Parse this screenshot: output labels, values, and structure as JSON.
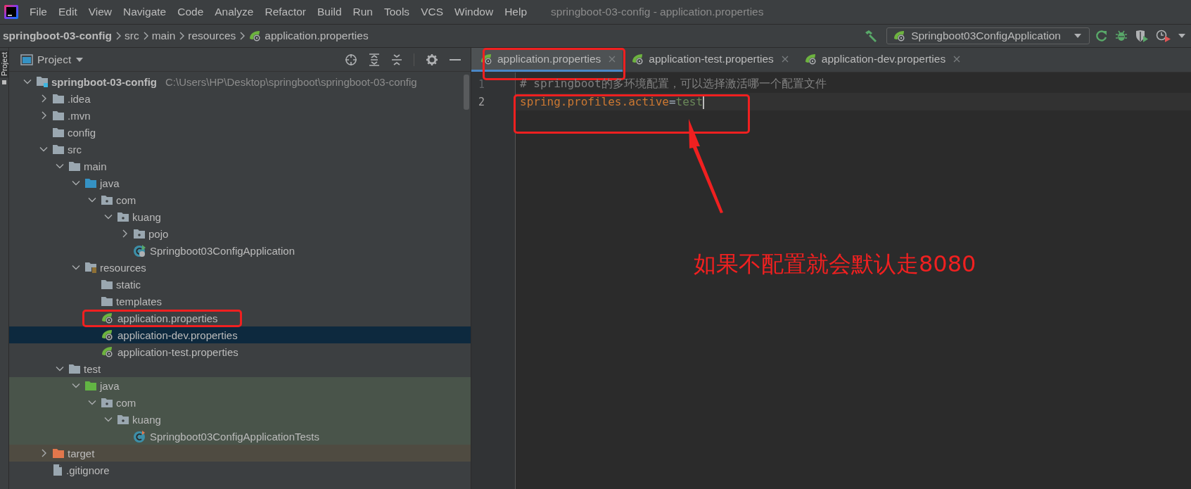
{
  "menu_bar": {
    "items": [
      "File",
      "Edit",
      "View",
      "Navigate",
      "Code",
      "Analyze",
      "Refactor",
      "Build",
      "Run",
      "Tools",
      "VCS",
      "Window",
      "Help"
    ],
    "title": "springboot-03-config - application.properties"
  },
  "navigation_bar": {
    "breadcrumbs": [
      {
        "label": "springboot-03-config",
        "kind": "project"
      },
      {
        "label": "src",
        "kind": "folder"
      },
      {
        "label": "main",
        "kind": "folder"
      },
      {
        "label": "resources",
        "kind": "folder"
      },
      {
        "label": "application.properties",
        "kind": "spring-file"
      }
    ],
    "run_configuration": "Springboot03ConfigApplication"
  },
  "tool_stripe": {
    "label": "Project"
  },
  "project_panel": {
    "title": "Project",
    "tree": [
      {
        "label": "springboot-03-config",
        "path": "C:\\Users\\HP\\Desktop\\springboot\\springboot-03-config",
        "kind": "module",
        "expanded": true,
        "selected": false,
        "children": [
          {
            "label": ".idea",
            "kind": "folder",
            "expanded": false,
            "selected": false
          },
          {
            "label": ".mvn",
            "kind": "folder",
            "expanded": false,
            "selected": false
          },
          {
            "label": "config",
            "kind": "folder",
            "selected": false
          },
          {
            "label": "src",
            "kind": "folder",
            "expanded": true,
            "selected": false,
            "children": [
              {
                "label": "main",
                "kind": "folder",
                "expanded": true,
                "selected": false,
                "children": [
                  {
                    "label": "java",
                    "kind": "source-folder",
                    "expanded": true,
                    "selected": false,
                    "children": [
                      {
                        "label": "com",
                        "kind": "package",
                        "expanded": true,
                        "selected": false,
                        "children": [
                          {
                            "label": "kuang",
                            "kind": "package",
                            "expanded": true,
                            "selected": false,
                            "children": [
                              {
                                "label": "pojo",
                                "kind": "package",
                                "expanded": false,
                                "selected": false
                              },
                              {
                                "label": "Springboot03ConfigApplication",
                                "kind": "spring-class",
                                "selected": false
                              }
                            ]
                          }
                        ]
                      }
                    ]
                  },
                  {
                    "label": "resources",
                    "kind": "resources-folder",
                    "expanded": true,
                    "selected": false,
                    "children": [
                      {
                        "label": "static",
                        "kind": "folder",
                        "selected": false
                      },
                      {
                        "label": "templates",
                        "kind": "folder",
                        "selected": false
                      },
                      {
                        "label": "application.properties",
                        "kind": "spring-file",
                        "selected": false,
                        "framed": true
                      },
                      {
                        "label": "application-dev.properties",
                        "kind": "spring-file",
                        "selected": true
                      },
                      {
                        "label": "application-test.properties",
                        "kind": "spring-file",
                        "selected": false
                      }
                    ]
                  }
                ]
              },
              {
                "label": "test",
                "kind": "folder",
                "expanded": true,
                "selected": false,
                "children": [
                  {
                    "label": "java",
                    "kind": "test-folder",
                    "expanded": true,
                    "selected": false,
                    "test_scope": true,
                    "children": [
                      {
                        "label": "com",
                        "kind": "package",
                        "expanded": true,
                        "selected": false,
                        "test_scope": true,
                        "children": [
                          {
                            "label": "kuang",
                            "kind": "package",
                            "expanded": true,
                            "selected": false,
                            "test_scope": true,
                            "children": [
                              {
                                "label": "Springboot03ConfigApplicationTests",
                                "kind": "test-class",
                                "selected": false,
                                "test_scope": true
                              }
                            ]
                          }
                        ]
                      }
                    ]
                  }
                ]
              }
            ]
          },
          {
            "label": "target",
            "kind": "excluded-folder",
            "expanded": false,
            "selected": false,
            "excluded": true
          },
          {
            "label": ".gitignore",
            "kind": "file",
            "selected": false
          }
        ]
      }
    ]
  },
  "editor": {
    "tabs": [
      {
        "label": "application.properties",
        "selected": true,
        "framed": true
      },
      {
        "label": "application-test.properties",
        "selected": false
      },
      {
        "label": "application-dev.properties",
        "selected": false
      }
    ],
    "lines": [
      {
        "number": "1",
        "current": false,
        "tokens": [
          {
            "text": "# springboot的多环境配置，可以选择激活哪一个配置文件",
            "kind": "comment"
          }
        ]
      },
      {
        "number": "2",
        "current": true,
        "framed": true,
        "tokens": [
          {
            "text": "spring.profiles.active",
            "kind": "key"
          },
          {
            "text": "=",
            "kind": "operator"
          },
          {
            "text": "test",
            "kind": "value"
          }
        ]
      }
    ]
  },
  "annotation": {
    "note": "如果不配置就会默认走8080"
  }
}
